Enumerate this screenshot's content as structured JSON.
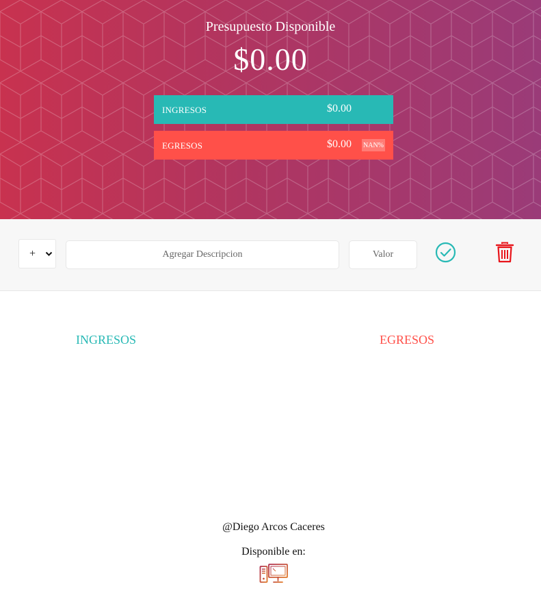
{
  "header": {
    "title": "Presupuesto Disponible",
    "total": "$0.00",
    "income": {
      "label": "INGRESOS",
      "value": "$0.00"
    },
    "expense": {
      "label": "EGRESOS",
      "value": "$0.00",
      "percentage": "NAN%"
    }
  },
  "form": {
    "type_selected": "+",
    "description_placeholder": "Agregar Descripcion",
    "value_placeholder": "Valor"
  },
  "lists": {
    "income_title": "INGRESOS",
    "expense_title": "EGRESOS"
  },
  "footer": {
    "author": "@Diego Arcos Caceres",
    "available": "Disponible en:"
  },
  "icons": {
    "confirm": "check-circle-icon",
    "delete": "trash-icon",
    "platform": "desktop-computer-icon"
  },
  "colors": {
    "income": "#28b9b5",
    "expense": "#ff5049",
    "delete": "#e8141a"
  }
}
